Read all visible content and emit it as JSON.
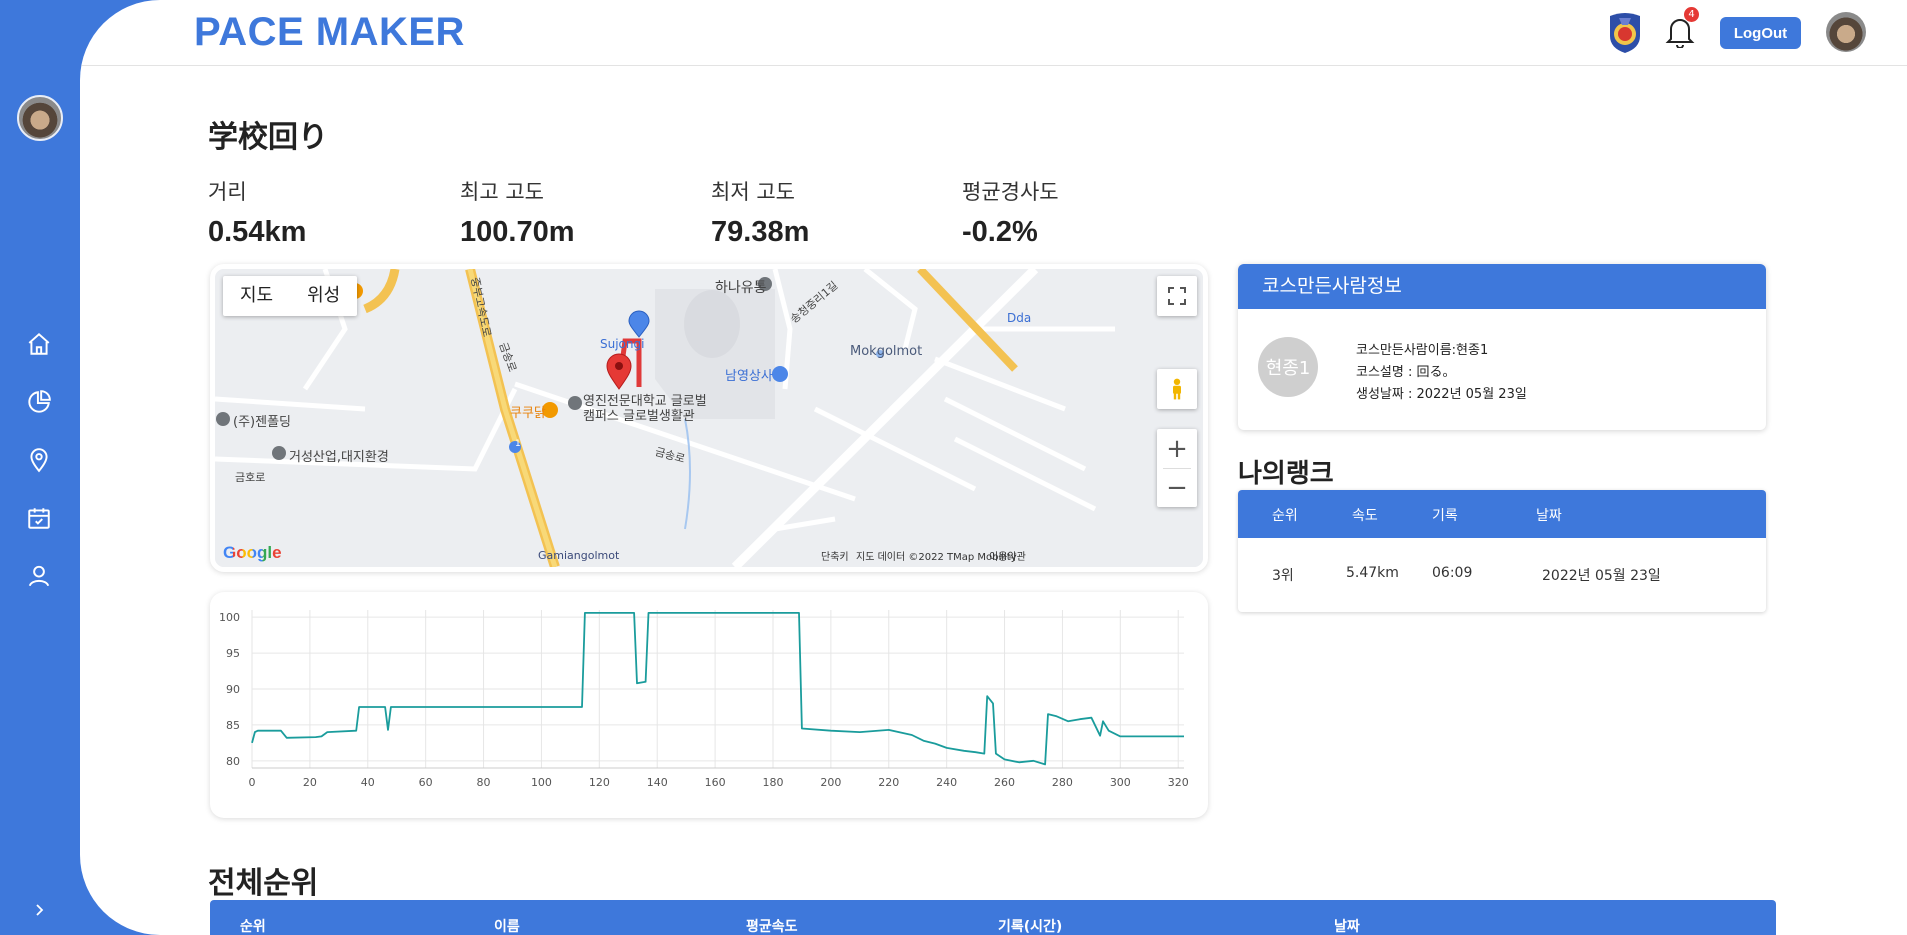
{
  "app": {
    "brand": "PACE MAKER"
  },
  "header": {
    "notification_count": "4",
    "logout_label": "LogOut"
  },
  "sidebar": {
    "items": [
      {
        "icon": "home-icon"
      },
      {
        "icon": "chart-pie-icon"
      },
      {
        "icon": "location-icon"
      },
      {
        "icon": "calendar-check-icon"
      },
      {
        "icon": "user-icon"
      }
    ],
    "expand_icon": "chevron-right-icon"
  },
  "course": {
    "title": "学校回り",
    "stats": [
      {
        "label": "거리",
        "value": "0.54km"
      },
      {
        "label": "최고 고도",
        "value": "100.70m"
      },
      {
        "label": "최저 고도",
        "value": "79.38m"
      },
      {
        "label": "평균경사도",
        "value": "-0.2%"
      }
    ]
  },
  "map": {
    "tabs": [
      "지도",
      "위성"
    ],
    "labels": {
      "hana": "하나유통",
      "songcheong": "송청중리1길",
      "sujong": "Sujongi",
      "mokgol": "Mokgolmot",
      "namyoung": "남영상사",
      "kukudak": "쿠쿠닭",
      "yeongjin1": "영진전문대학교 글로벌",
      "yeongjin2": "캠퍼스 글로벌생활관",
      "jenpolding": "(주)젠폴딩",
      "geoseong": "거성산업,대지환경",
      "geumsong1": "금송로",
      "geumsong2": "금송로",
      "geumho": "금호로",
      "gamiang": "Gamiangolmot",
      "dda": "Dda",
      "highway": "중부고속도로",
      "route": "1"
    },
    "footer": {
      "shortcuts": "단축키",
      "data": "지도 데이터 ©2022 TMap Mobility",
      "terms": "이용약관"
    },
    "google": "Google"
  },
  "chart_data": {
    "type": "line",
    "title": "",
    "xlabel": "",
    "ylabel": "",
    "xlim": [
      0,
      322
    ],
    "ylim": [
      79,
      101
    ],
    "xticks": [
      0,
      20,
      40,
      60,
      80,
      100,
      120,
      140,
      160,
      180,
      200,
      220,
      240,
      260,
      280,
      300,
      320
    ],
    "yticks": [
      80,
      85,
      90,
      95,
      100
    ],
    "grid": true,
    "series": [
      {
        "color": "#1a9c9c",
        "x": [
          0,
          1,
          2,
          10,
          12,
          22,
          24,
          26,
          36,
          37,
          46,
          47,
          48,
          49,
          114,
          115,
          132,
          133,
          136,
          137,
          189,
          190,
          200,
          210,
          220,
          228,
          232,
          236,
          240,
          246,
          250,
          253,
          254,
          256,
          257,
          260,
          265,
          270,
          274,
          275,
          278,
          282,
          286,
          290,
          293,
          294,
          296,
          300,
          305,
          322
        ],
        "y": [
          82.5,
          84,
          84.2,
          84.2,
          83.2,
          83.3,
          83.4,
          84,
          84.2,
          87.5,
          87.5,
          84.3,
          87.5,
          87.5,
          87.5,
          100.6,
          100.6,
          90.8,
          91,
          100.6,
          100.6,
          84.5,
          84.2,
          84,
          84.3,
          83.6,
          82.8,
          82.4,
          81.8,
          81.4,
          81.2,
          81,
          89,
          88,
          81,
          80.2,
          79.8,
          80,
          79.5,
          86.5,
          86.2,
          85.5,
          85.8,
          86,
          83.5,
          85.5,
          84.2,
          83.4,
          83.4,
          83.4
        ]
      }
    ]
  },
  "creator": {
    "header": "코스만든사람정보",
    "avatar_text": "현종1",
    "name_line": "코스만든사람이름:현종1",
    "desc_line": "코스설명 : 回る。",
    "date_line": "생성날짜 : 2022년 05월 23일"
  },
  "my_rank": {
    "title": "나의랭크",
    "columns": [
      "순위",
      "속도",
      "기록",
      "날짜"
    ],
    "row": {
      "rank": "3위",
      "speed": "5.47km",
      "record": "06:09",
      "date": "2022년 05월 23일"
    }
  },
  "all_rank": {
    "title": "전체순위",
    "columns": [
      "순위",
      "이름",
      "평균속도",
      "기록(시간)",
      "날짜"
    ]
  }
}
